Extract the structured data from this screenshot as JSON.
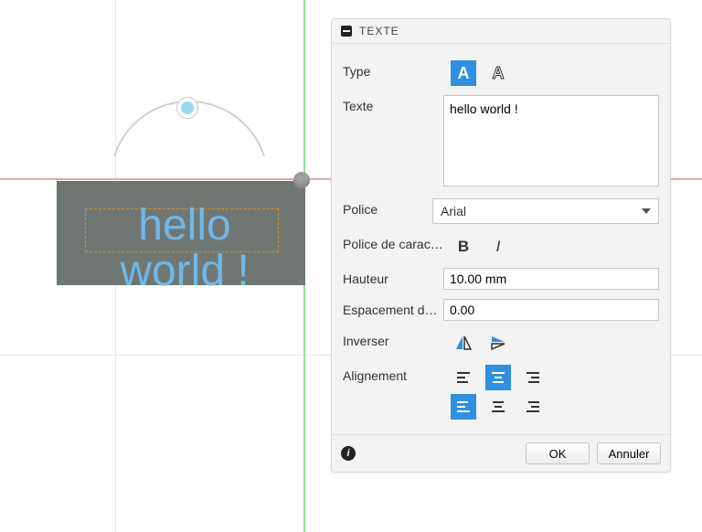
{
  "panel": {
    "title": "TEXTE",
    "type_label": "Type",
    "text_label": "Texte",
    "text_value": "hello world !",
    "font_label": "Police",
    "font_value": "Arial",
    "style_label": "Police de carac…",
    "height_label": "Hauteur",
    "height_value": "10.00 mm",
    "spacing_label": "Espacement d…",
    "spacing_value": "0.00",
    "flip_label": "Inverser",
    "align_label": "Alignement",
    "ok_label": "OK",
    "cancel_label": "Annuler"
  },
  "preview": {
    "line1": "hello",
    "line2": "world !"
  },
  "colors": {
    "accent": "#2f8fe0",
    "rect": "#707773",
    "text_preview": "#6fb8e8"
  }
}
